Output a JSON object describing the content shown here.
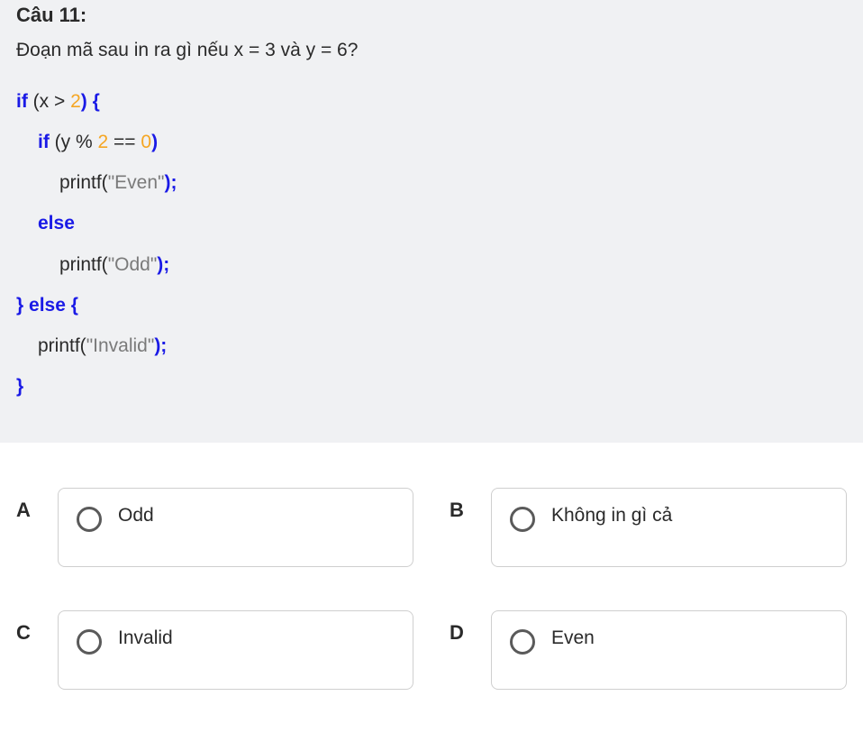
{
  "question": {
    "title": "Câu 11:",
    "text": "Đoạn mã sau in ra gì nếu x = 3 và y = 6?"
  },
  "code": {
    "line1_if": "if",
    "line1_open": " (x > ",
    "line1_num": "2",
    "line1_close": ") {",
    "line2_if": "if",
    "line2_open": " (y % ",
    "line2_num1": "2",
    "line2_eq": " == ",
    "line2_num2": "0",
    "line2_close": ")",
    "line3_fn": "printf(",
    "line3_str": "\"Even\"",
    "line3_end": ");",
    "line4_else": "else",
    "line5_fn": "printf(",
    "line5_str": "\"Odd\"",
    "line5_end": ");",
    "line6_close": "} ",
    "line6_else": "else",
    "line6_open": " {",
    "line7_fn": "printf(",
    "line7_str": "\"Invalid\"",
    "line7_end": ");",
    "line8_close": "}"
  },
  "answers": {
    "a": {
      "letter": "A",
      "text": "Odd"
    },
    "b": {
      "letter": "B",
      "text": "Không in gì cả"
    },
    "c": {
      "letter": "C",
      "text": "Invalid"
    },
    "d": {
      "letter": "D",
      "text": "Even"
    }
  }
}
